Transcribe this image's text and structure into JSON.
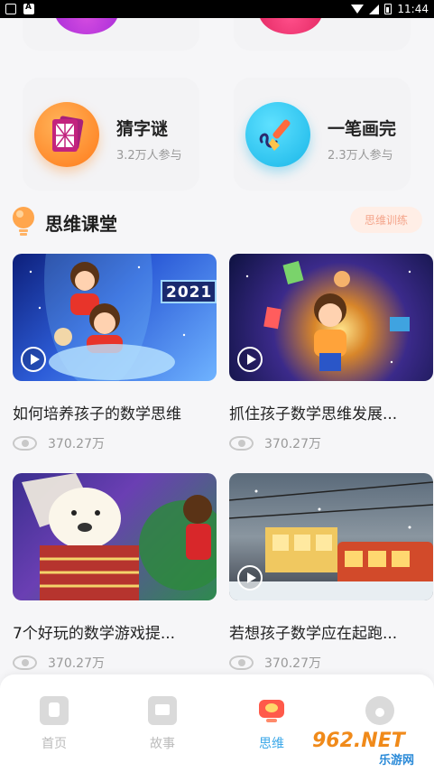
{
  "status_bar": {
    "time": "11:44"
  },
  "games": [
    {
      "title": "猜字谜",
      "subtitle": "3.2万人参与",
      "icon": "puzzle-grid-icon"
    },
    {
      "title": "一笔画完",
      "subtitle": "2.3万人参与",
      "icon": "paintbrush-icon"
    }
  ],
  "section": {
    "title": "思维课堂",
    "button": "思维训练"
  },
  "videos": [
    {
      "title": "如何培养孩子的数学思维",
      "views": "370.27万",
      "thumb_text": "2021"
    },
    {
      "title": "抓住孩子数学思维发展...",
      "views": "370.27万"
    },
    {
      "title": "7个好玩的数学游戏提...",
      "views": "370.27万"
    },
    {
      "title": "若想孩子数学应在起跑...",
      "views": "370.27万"
    }
  ],
  "nav": [
    {
      "label": "首页",
      "icon": "home-icon"
    },
    {
      "label": "故事",
      "icon": "story-icon"
    },
    {
      "label": "思维",
      "icon": "thinking-icon",
      "active": true
    },
    {
      "label": "",
      "icon": "profile-icon"
    }
  ],
  "watermark": {
    "text": "962.NET",
    "sub": "乐游网"
  },
  "colors": {
    "accent_blue": "#3aa7e8",
    "section_btn_text": "#f4a48a",
    "section_btn_bg": "#ffeee6"
  }
}
